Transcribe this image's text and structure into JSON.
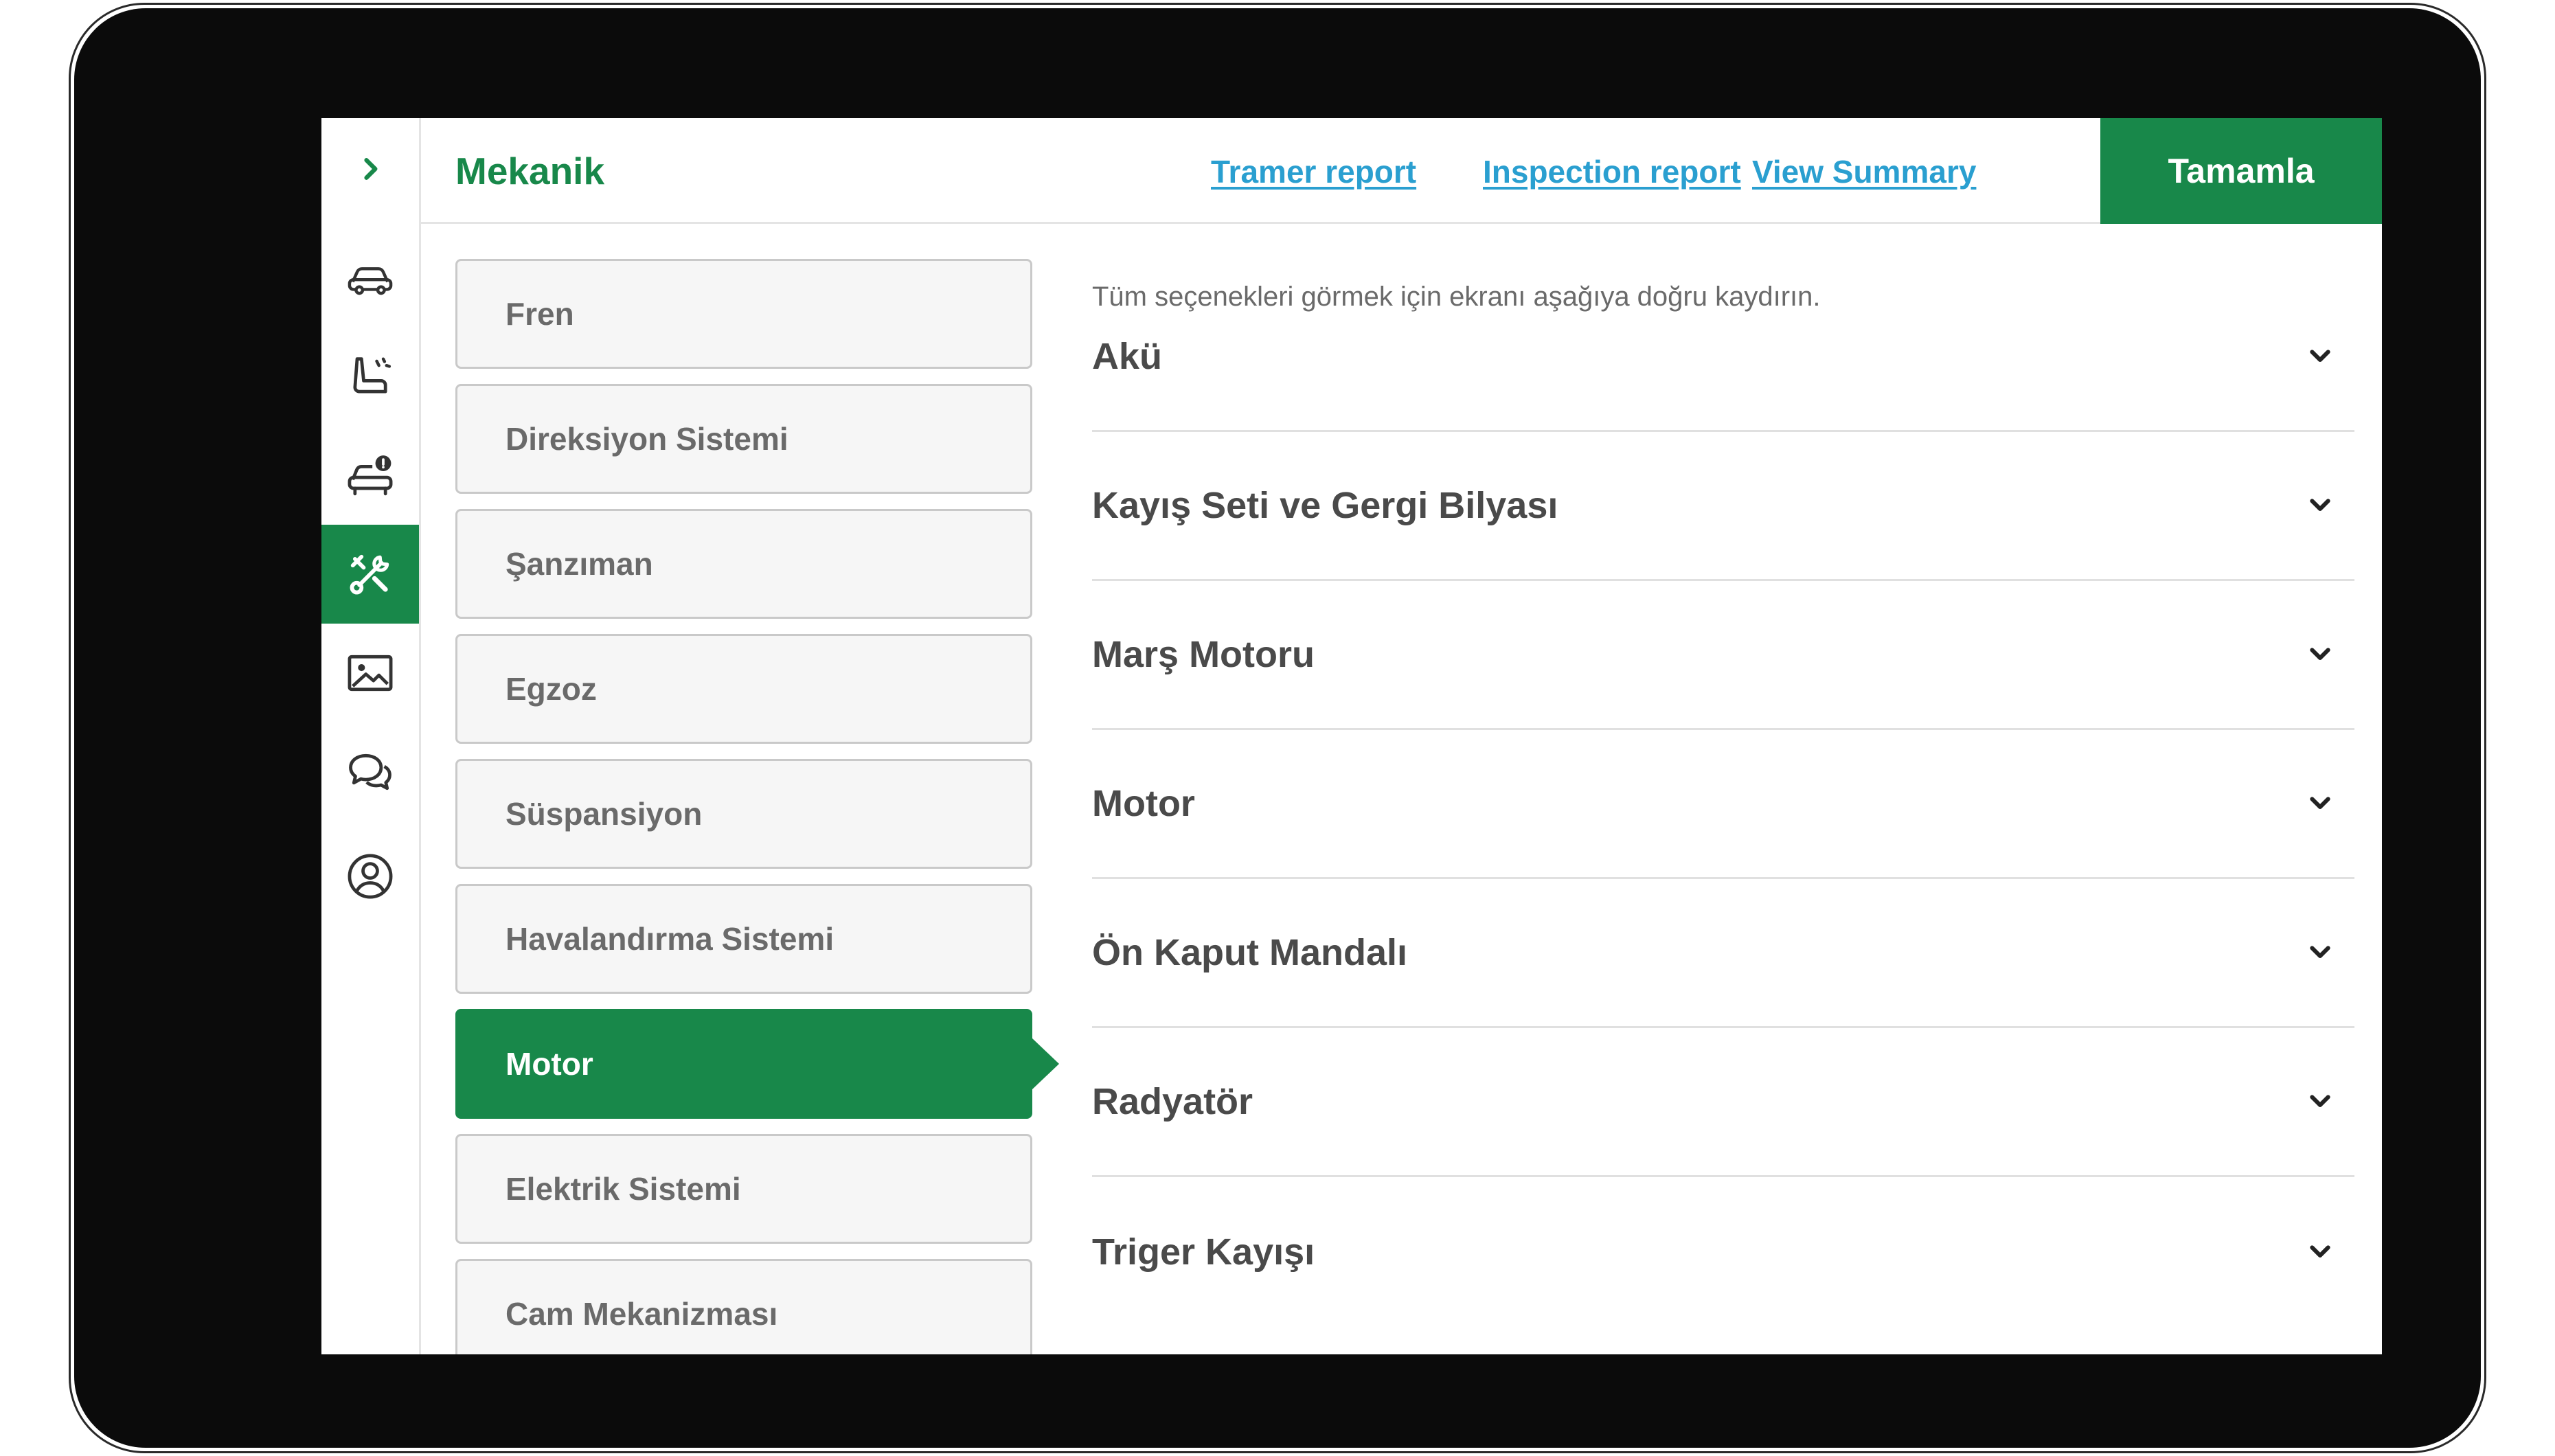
{
  "header": {
    "title": "Mekanik",
    "links": [
      "Tramer report",
      "Inspection report",
      "View Summary"
    ],
    "complete_label": "Tamamla"
  },
  "rail": {
    "icons": [
      "chevron-right-icon",
      "car-icon",
      "car-seat-icon",
      "car-warning-icon",
      "tools-icon",
      "image-icon",
      "chat-icon",
      "user-circle-icon"
    ],
    "active_index": 4
  },
  "categories": [
    "Fren",
    "Direksiyon Sistemi",
    "Şanzıman",
    "Egzoz",
    "Süspansiyon",
    "Havalandırma Sistemi",
    "Motor",
    "Elektrik Sistemi",
    "Cam Mekanizması"
  ],
  "active_category": "Motor",
  "panel": {
    "hint": "Tüm seçenekleri görmek için ekranı aşağıya doğru kaydırın.",
    "items": [
      "Akü",
      "Kayış Seti ve Gergi Bilyası",
      "Marş Motoru",
      "Motor",
      "Ön Kaput Mandalı",
      "Radyatör",
      "Triger Kayışı"
    ]
  },
  "colors": {
    "brand_green": "#18884a",
    "link_blue": "#2a9fd0",
    "text_gray": "#4a4a4a"
  }
}
